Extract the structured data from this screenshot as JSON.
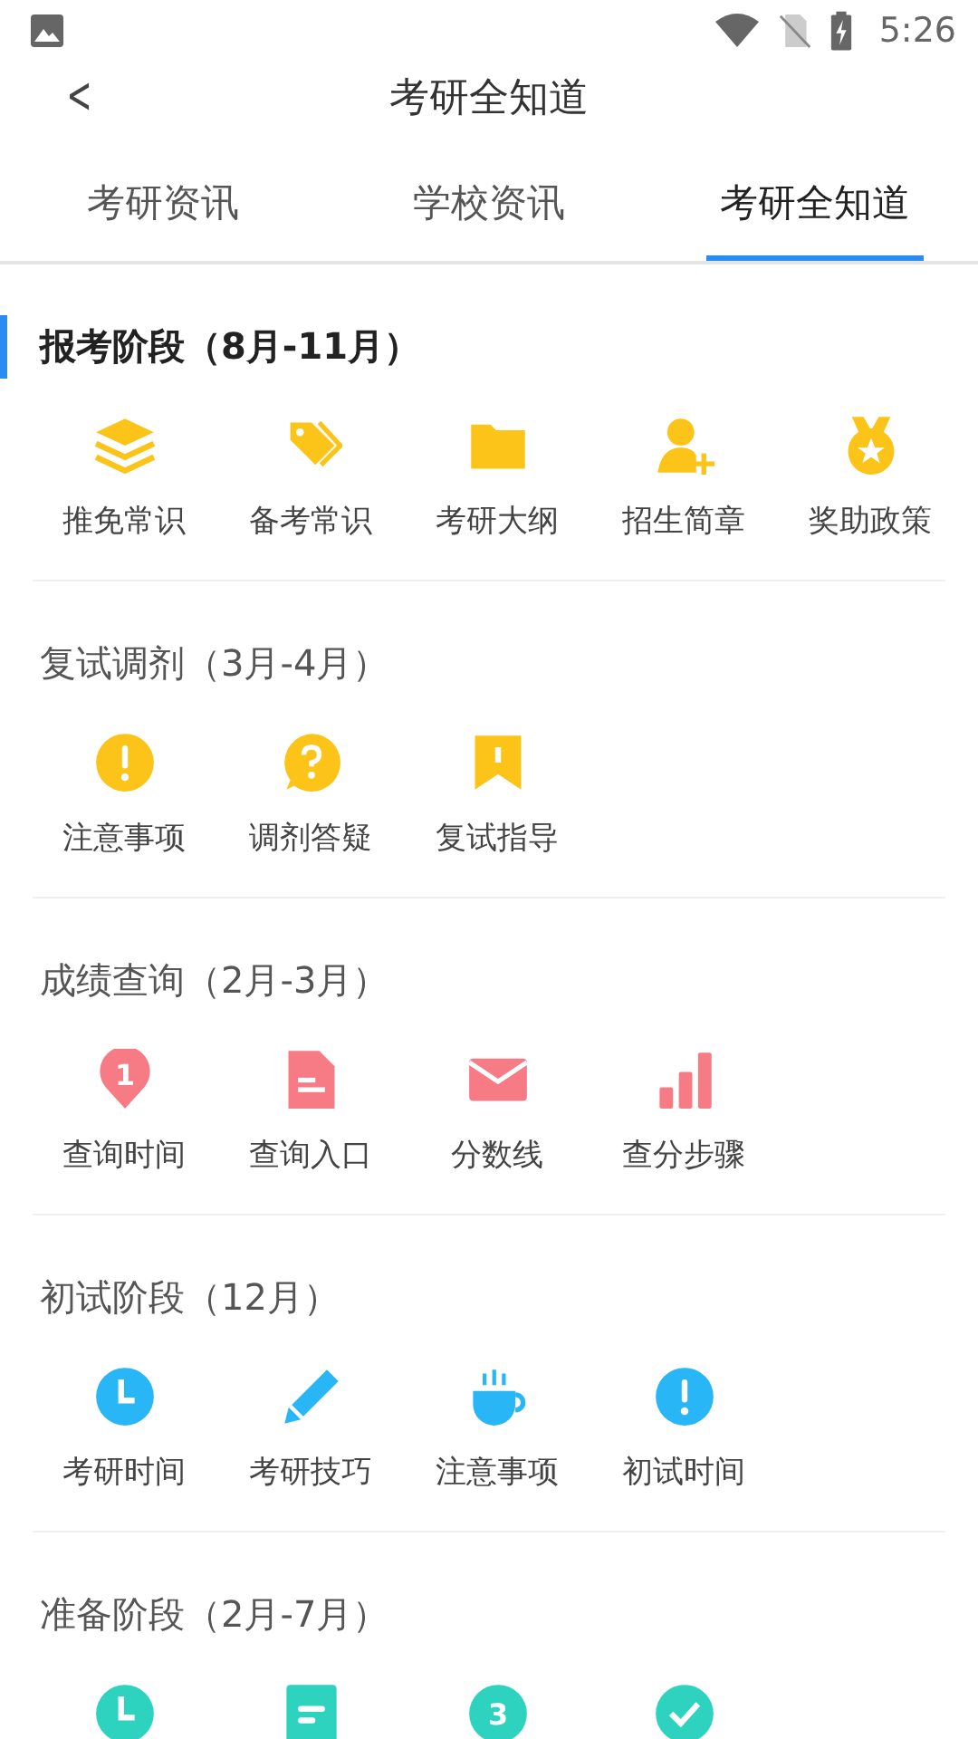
{
  "status_bar": {
    "time": "5:26"
  },
  "header": {
    "title": "考研全知道",
    "back": "<"
  },
  "tabs": [
    {
      "label": "考研资讯",
      "selected": false
    },
    {
      "label": "学校资讯",
      "selected": false
    },
    {
      "label": "考研全知道",
      "selected": true
    }
  ],
  "sections": [
    {
      "title": "报考阶段（8月-11月）",
      "selected": true,
      "color": "#fcc419",
      "items": [
        {
          "kind": "tile",
          "label": "推免常识"
        },
        {
          "kind": "tile",
          "label": "备考常识"
        },
        {
          "kind": "tile",
          "label": "考研大纲"
        },
        {
          "kind": "tile",
          "label": "招生简章"
        },
        {
          "kind": "tile",
          "label": "奖助政策"
        }
      ]
    },
    {
      "title": "复试调剂（3月-4月）",
      "selected": false,
      "color": "#fcc419",
      "items": [
        {
          "kind": "tile",
          "label": "注意事项"
        },
        {
          "kind": "tile",
          "label": "调剂答疑"
        },
        {
          "kind": "tile",
          "label": "复试指导"
        }
      ]
    },
    {
      "title": "成绩查询（2月-3月）",
      "selected": false,
      "color": "#f77b85",
      "items": [
        {
          "kind": "tile",
          "label": "查询时间",
          "icon_text": "1"
        },
        {
          "kind": "tile",
          "label": "查询入口"
        },
        {
          "kind": "tile",
          "label": "分数线"
        },
        {
          "kind": "tile",
          "label": "查分步骤"
        }
      ]
    },
    {
      "title": "初试阶段（12月）",
      "selected": false,
      "color": "#29b6f6",
      "items": [
        {
          "kind": "tile",
          "label": "考研时间"
        },
        {
          "kind": "tile",
          "label": "考研技巧"
        },
        {
          "kind": "tile",
          "label": "注意事项"
        },
        {
          "kind": "tile",
          "label": "初试时间"
        }
      ]
    },
    {
      "title": "准备阶段（2月-7月）",
      "selected": false,
      "color": "#2ed3bf",
      "items": [
        {
          "kind": "icon"
        },
        {
          "kind": "icon"
        },
        {
          "kind": "icon",
          "icon_text": "3"
        },
        {
          "kind": "icon"
        }
      ]
    }
  ]
}
